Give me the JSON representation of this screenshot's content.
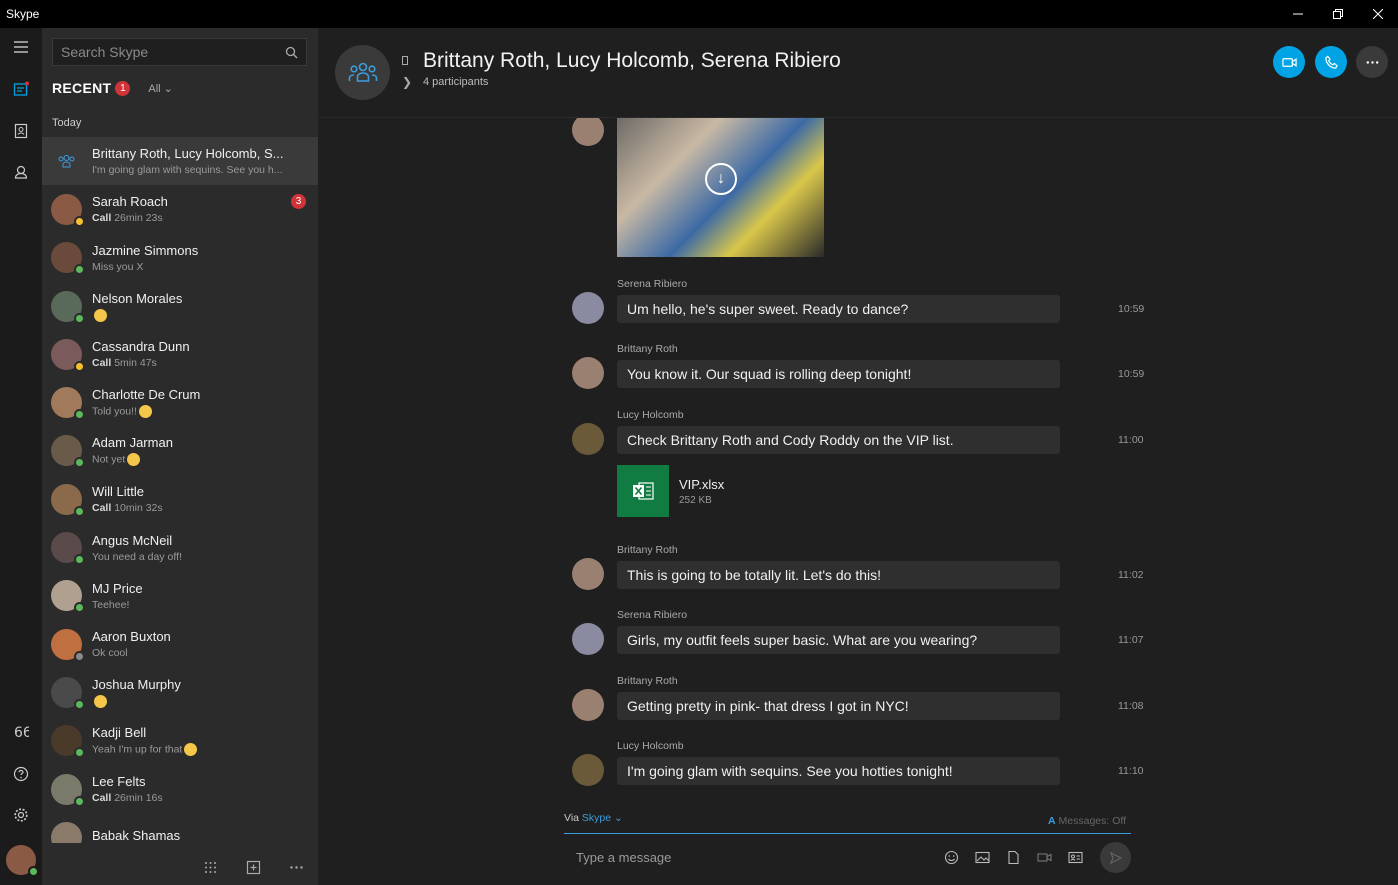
{
  "app": {
    "title": "Skype"
  },
  "colors": {
    "accent": "#00a3e4",
    "unread": "#d13438",
    "online": "#5cb85c",
    "away": "#f8c02c",
    "excel": "#107c41"
  },
  "sidebar": {
    "search_placeholder": "Search Skype",
    "recent_label": "RECENT",
    "recent_badge": "1",
    "filter_label": "All",
    "section_label": "Today",
    "conversations": [
      {
        "name": "Brittany Roth, Lucy Holcomb, S...",
        "sub": "I'm going glam with sequins. See you h...",
        "group": true,
        "selected": true,
        "avatar_color": "#3a3a3a"
      },
      {
        "name": "Sarah Roach",
        "sub_bold": "Call",
        "sub": "26min 23s",
        "badge": "3",
        "presence": "away",
        "avatar_color": "#8a5a44"
      },
      {
        "name": "Jazmine Simmons",
        "sub": "Miss you X",
        "presence": "online",
        "avatar_color": "#6a4a3a"
      },
      {
        "name": "Nelson Morales",
        "sub": "",
        "emoji": true,
        "presence": "online",
        "avatar_color": "#5a6a5a"
      },
      {
        "name": "Cassandra Dunn",
        "sub_bold": "Call",
        "sub": "5min 47s",
        "presence": "away",
        "avatar_color": "#7a5a5a"
      },
      {
        "name": "Charlotte De Crum",
        "sub": "Told you!!",
        "emoji": true,
        "presence": "online",
        "avatar_color": "#a07a5a"
      },
      {
        "name": "Adam Jarman",
        "sub": "Not yet",
        "emoji": true,
        "presence": "online",
        "avatar_color": "#6a5a4a"
      },
      {
        "name": "Will Little",
        "sub_bold": "Call",
        "sub": "10min 32s",
        "presence": "online",
        "avatar_color": "#8a6a4a"
      },
      {
        "name": "Angus McNeil",
        "sub": "You need a day off!",
        "presence": "online",
        "avatar_color": "#5a4a4a"
      },
      {
        "name": "MJ Price",
        "sub": "Teehee!",
        "presence": "online",
        "avatar_color": "#b0a090"
      },
      {
        "name": "Aaron Buxton",
        "sub": "Ok cool",
        "presence": "offline",
        "avatar_color": "#c07040"
      },
      {
        "name": "Joshua Murphy",
        "sub": "",
        "emoji": true,
        "presence": "online",
        "avatar_color": "#4a4a4a"
      },
      {
        "name": "Kadji Bell",
        "sub": "Yeah I'm up for that",
        "emoji": true,
        "presence": "online",
        "avatar_color": "#4a3a2a"
      },
      {
        "name": "Lee Felts",
        "sub_bold": "Call",
        "sub": "26min 16s",
        "presence": "online",
        "avatar_color": "#7a7a6a"
      },
      {
        "name": "Babak Shamas",
        "sub": "",
        "presence": "online",
        "avatar_color": "#8a7a6a"
      }
    ]
  },
  "chat": {
    "title": "Brittany Roth, Lucy Holcomb, Serena Ribiero",
    "participants": "4 participants",
    "messages": [
      {
        "sender": "Serena Ribiero",
        "text": "Um hello, he's super sweet. Ready to dance?",
        "time": "10:59",
        "avatar_color": "#8a8aa0"
      },
      {
        "sender": "Brittany Roth",
        "text": "You know it. Our squad is rolling deep tonight!",
        "time": "10:59",
        "avatar_color": "#9a8070"
      },
      {
        "sender": "Lucy Holcomb",
        "text": "Check Brittany Roth and Cody Roddy on the VIP list.",
        "time": "11:00",
        "avatar_color": "#6a5a3a"
      },
      {
        "sender": "Brittany Roth",
        "text": "This is going to be totally lit. Let's do this!",
        "time": "11:02",
        "avatar_color": "#9a8070"
      },
      {
        "sender": "Serena Ribiero",
        "text": "Girls, my outfit feels super basic. What are you wearing?",
        "time": "11:07",
        "avatar_color": "#8a8aa0"
      },
      {
        "sender": "Brittany Roth",
        "text": "Getting pretty in pink- that dress I got in NYC!",
        "time": "11:08",
        "avatar_color": "#9a8070"
      },
      {
        "sender": "Lucy Holcomb",
        "text": "I'm going glam with sequins. See you hotties tonight!",
        "time": "11:10",
        "avatar_color": "#6a5a3a"
      }
    ],
    "attachment": {
      "name": "VIP.xlsx",
      "size": "252 KB"
    }
  },
  "compose": {
    "via_label": "Via",
    "via_link": "Skype",
    "messages_status": "Messages: Off",
    "placeholder": "Type a message"
  }
}
